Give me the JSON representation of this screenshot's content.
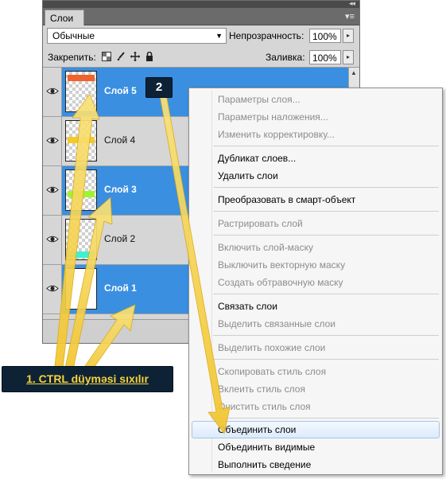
{
  "panel": {
    "tab_label": "Слои",
    "topstrip_glyph": "◂◂",
    "menu_glyph": "▾≡",
    "blend_mode": "Обычные",
    "opacity_label": "Непрозрачность:",
    "opacity_value": "100%",
    "lock_label": "Закрепить:",
    "fill_label": "Заливка:",
    "fill_value": "100%",
    "layers": [
      {
        "name": "Слой 5",
        "selected": true,
        "stripe_color": "#f0632e"
      },
      {
        "name": "Слой 4",
        "selected": false,
        "stripe_color": "#f5c926"
      },
      {
        "name": "Слой 3",
        "selected": true,
        "stripe_color": "#9ef52e"
      },
      {
        "name": "Слой 2",
        "selected": false,
        "stripe_color": "#3ef2d0"
      },
      {
        "name": "Слой 1",
        "selected": true,
        "stripe_color": null
      }
    ],
    "colors": {
      "selected": "#3a8fe0",
      "panel_bg": "#d6d6d6"
    }
  },
  "context_menu": {
    "groups": [
      [
        {
          "label": "Параметры слоя...",
          "enabled": false
        },
        {
          "label": "Параметры наложения...",
          "enabled": false
        },
        {
          "label": "Изменить корректировку...",
          "enabled": false
        }
      ],
      [
        {
          "label": "Дубликат слоев...",
          "enabled": true
        },
        {
          "label": "Удалить слои",
          "enabled": true
        }
      ],
      [
        {
          "label": "Преобразовать в смарт-объект",
          "enabled": true
        }
      ],
      [
        {
          "label": "Растрировать слой",
          "enabled": false
        }
      ],
      [
        {
          "label": "Включить слой-маску",
          "enabled": false
        },
        {
          "label": "Выключить векторную маску",
          "enabled": false
        },
        {
          "label": "Создать обтравочную маску",
          "enabled": false
        }
      ],
      [
        {
          "label": "Связать слои",
          "enabled": true
        },
        {
          "label": "Выделить связанные слои",
          "enabled": false
        }
      ],
      [
        {
          "label": "Выделить похожие слои",
          "enabled": false
        }
      ],
      [
        {
          "label": "Скопировать стиль слоя",
          "enabled": false
        },
        {
          "label": "Вклеить стиль слоя",
          "enabled": false
        },
        {
          "label": "Очистить стиль слоя",
          "enabled": false
        }
      ],
      [
        {
          "label": "Объединить слои",
          "enabled": true,
          "highlighted": true
        },
        {
          "label": "Объединить видимые",
          "enabled": true
        },
        {
          "label": "Выполнить сведение",
          "enabled": true
        }
      ]
    ]
  },
  "annotations": {
    "step2_badge": "2",
    "step1_label": "1. CTRL düyməsi sıxılır",
    "arrow_color": "#f7d548"
  }
}
